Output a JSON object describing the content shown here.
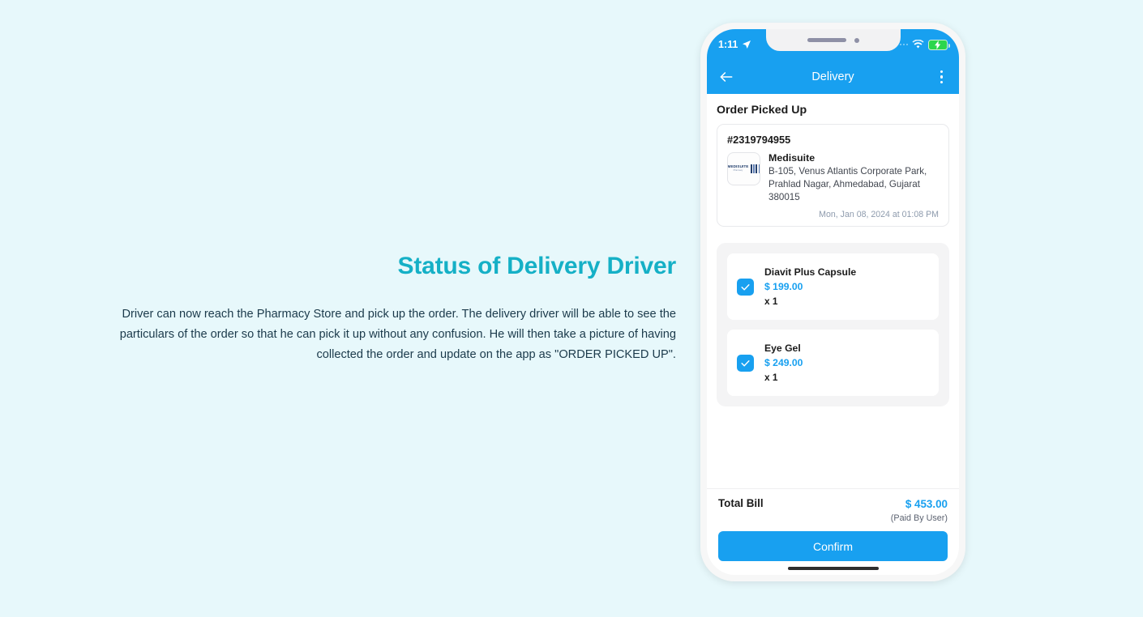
{
  "page": {
    "background_color": "#e7f8fb",
    "headline": "Status of Delivery Driver",
    "headline_color": "#15b0c6",
    "body": "Driver can now reach the Pharmacy Store and pick up the order. The delivery driver will be able to see the particulars of the order so that he can pick it up without any confusion. He will then take a picture of having collected the order and update on the app as \"ORDER PICKED UP\"."
  },
  "phone": {
    "status_bar": {
      "time": "1:11",
      "location_icon": "location-arrow-icon",
      "signal_icon": "signal-dots-icon",
      "wifi_icon": "wifi-icon",
      "battery_icon": "battery-charging-icon",
      "battery_color": "#2bd64c",
      "background_color": "#18a0f0"
    },
    "app_bar": {
      "back_icon": "back-arrow-icon",
      "title": "Delivery",
      "menu_icon": "kebab-menu-icon",
      "background_color": "#18a0f0"
    },
    "content": {
      "section_title": "Order Picked Up",
      "order_card": {
        "order_id": "#2319794955",
        "store_logo_word": "MEDISUITE",
        "store_logo_sub": "Pharmacy",
        "store_name": "Medisuite",
        "store_address": "B-105, Venus Atlantis Corporate Park, Prahlad Nagar, Ahmedabad, Gujarat 380015",
        "timestamp": "Mon, Jan 08, 2024 at 01:08 PM"
      },
      "items": [
        {
          "name": "Diavit Plus Capsule",
          "price": "$ 199.00",
          "quantity": "x 1",
          "checked": true
        },
        {
          "name": "Eye Gel",
          "price": "$ 249.00",
          "quantity": "x 1",
          "checked": true
        }
      ]
    },
    "bottom_bar": {
      "total_label": "Total Bill",
      "total_amount": "$ 453.00",
      "paid_note": "(Paid By User)",
      "confirm_label": "Confirm",
      "accent_color": "#18a0f0"
    }
  }
}
